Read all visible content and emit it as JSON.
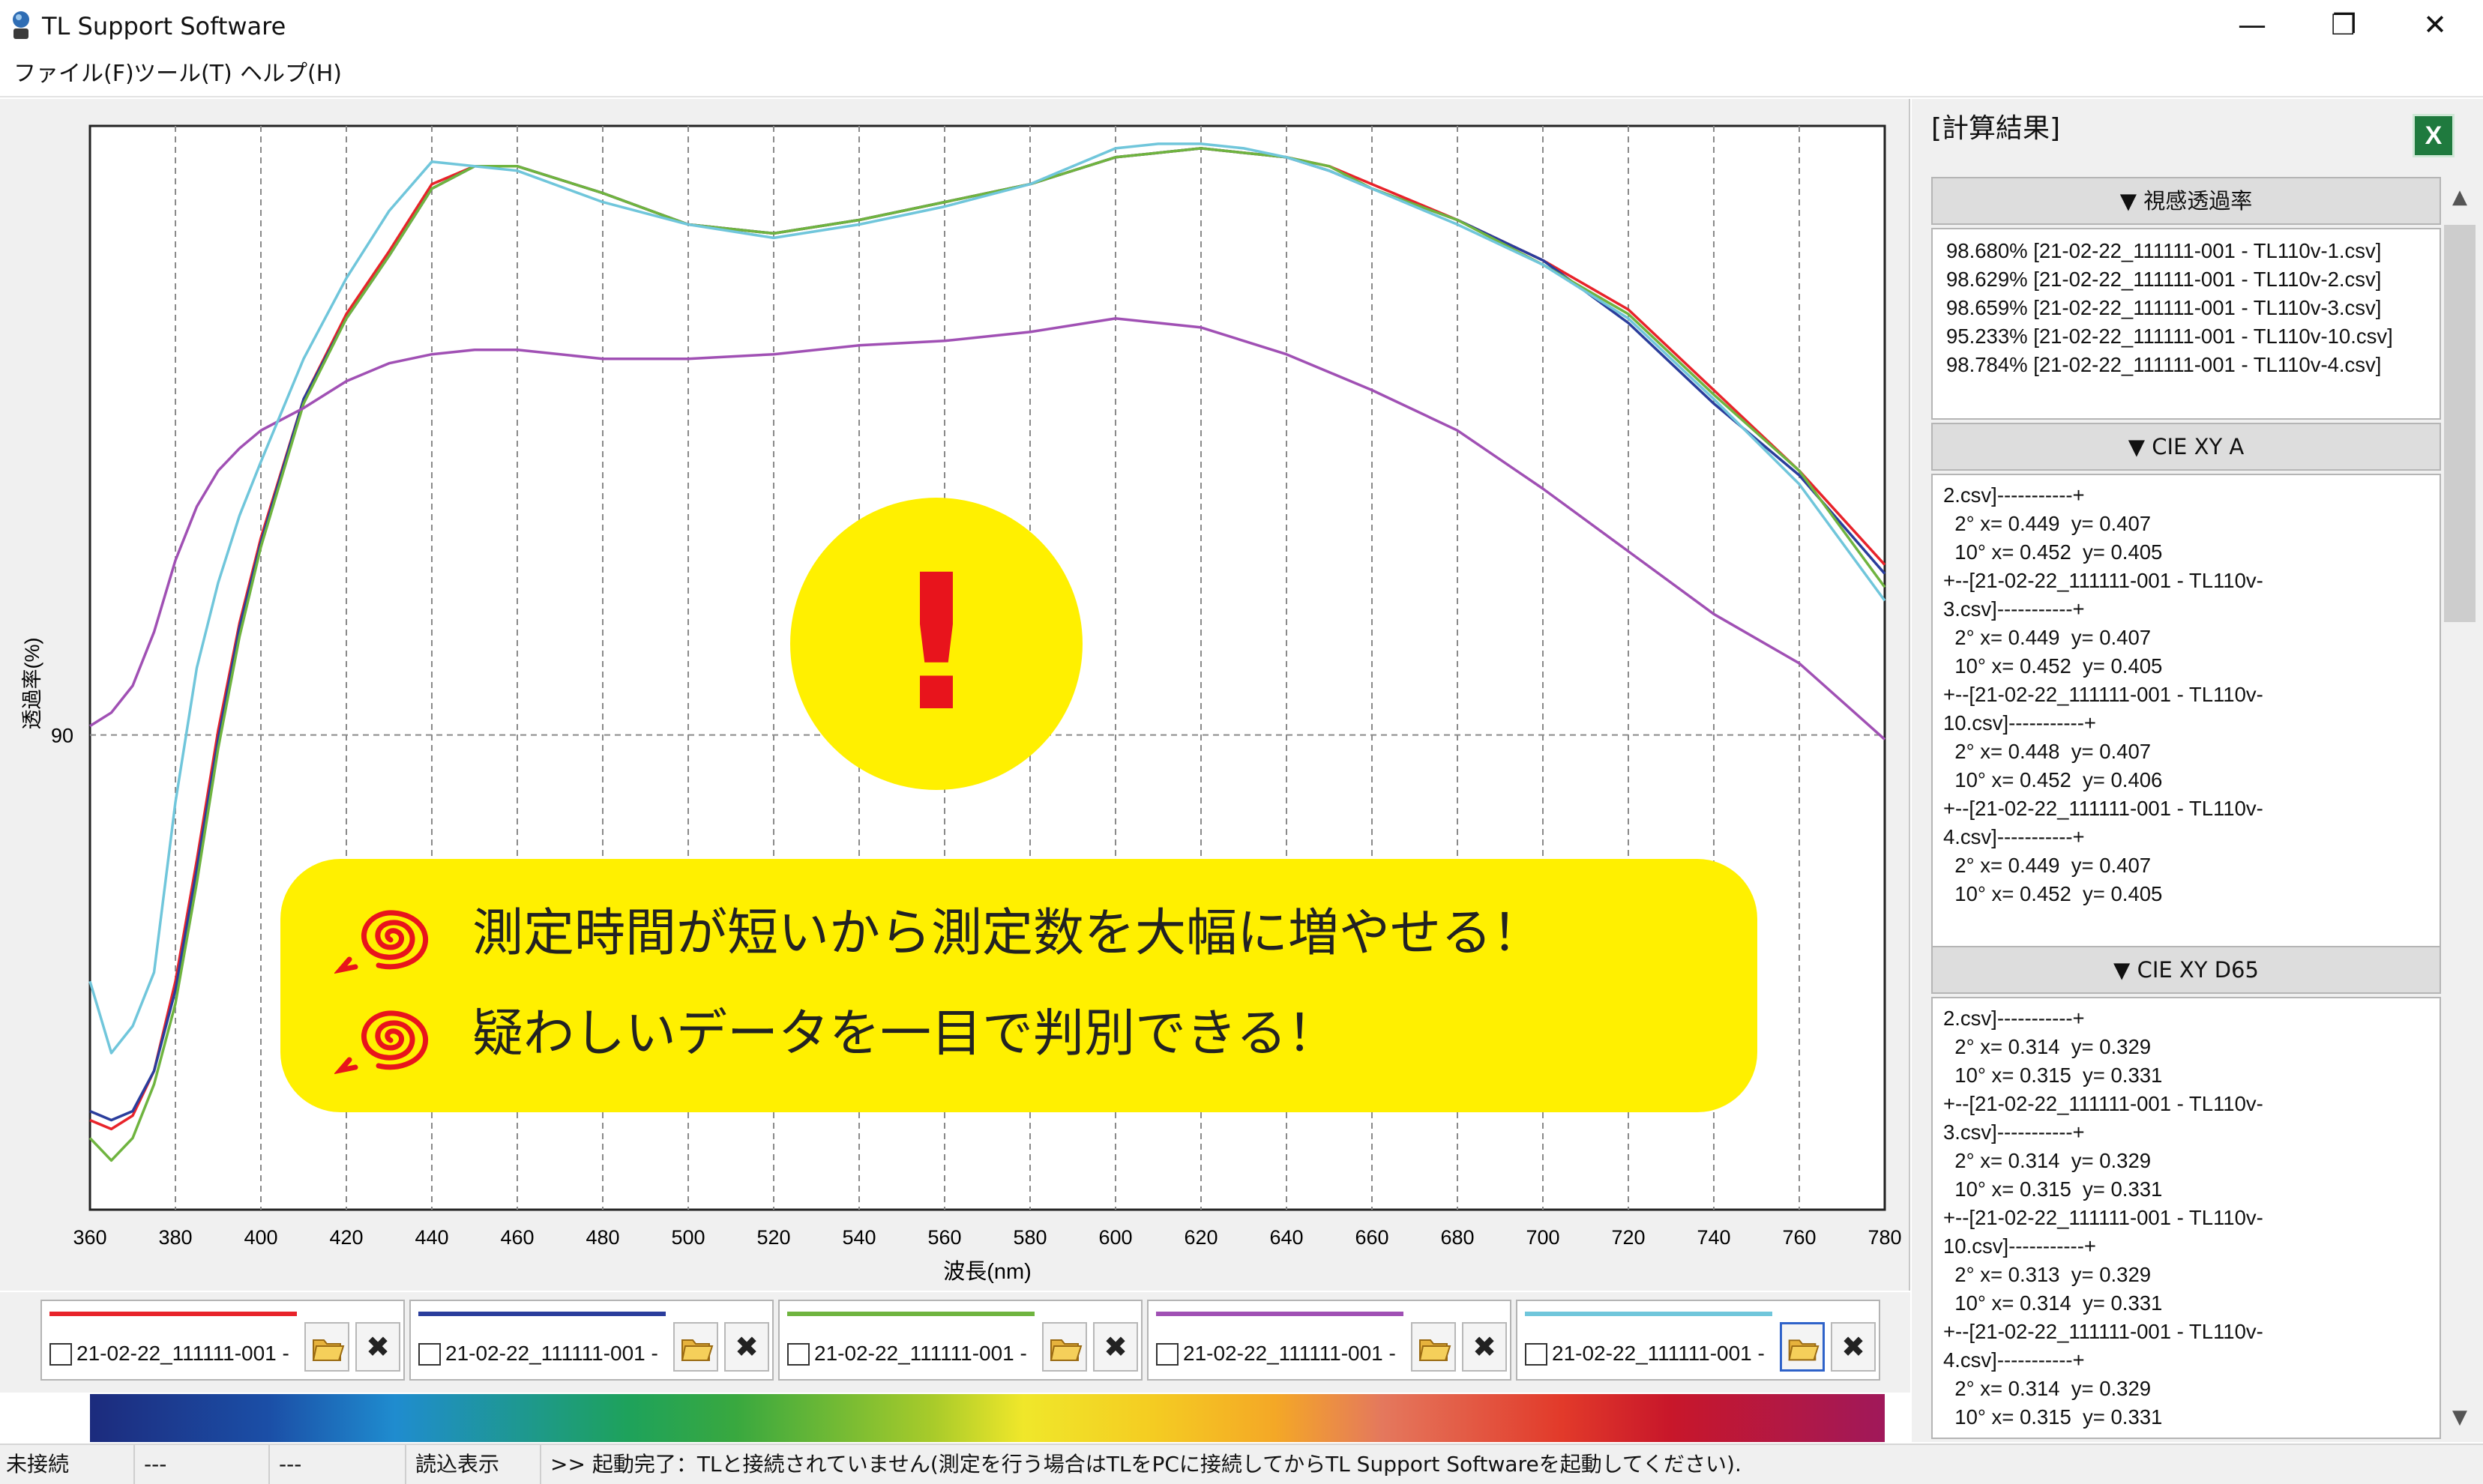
{
  "window": {
    "title": "TL Support Software",
    "controls": {
      "minimize": "—",
      "maximize": "❐",
      "close": "✕"
    }
  },
  "menu": [
    "ファイル(F)",
    "ツール(T)",
    "ヘルプ(H)"
  ],
  "chart_data": {
    "type": "line",
    "xlabel": "波長(nm)",
    "ylabel": "透過率(%)",
    "xlim": [
      360,
      780
    ],
    "x_ticks": [
      360,
      380,
      400,
      420,
      440,
      460,
      480,
      500,
      520,
      540,
      560,
      580,
      600,
      620,
      640,
      660,
      680,
      700,
      720,
      740,
      760,
      780
    ],
    "y_ticks": [
      90
    ],
    "y_tick_labels": [
      "90"
    ],
    "grid": true,
    "x": [
      360,
      365,
      370,
      375,
      380,
      385,
      390,
      395,
      400,
      410,
      420,
      430,
      440,
      450,
      460,
      480,
      500,
      520,
      540,
      560,
      580,
      600,
      610,
      620,
      630,
      640,
      650,
      660,
      680,
      700,
      720,
      740,
      760,
      780
    ],
    "series": [
      {
        "color": "#e8232a",
        "values": [
          89.14,
          89.12,
          89.15,
          89.25,
          89.45,
          89.72,
          90.01,
          90.25,
          90.44,
          90.75,
          90.94,
          91.08,
          91.23,
          91.27,
          91.27,
          91.21,
          91.14,
          91.12,
          91.15,
          91.19,
          91.23,
          91.29,
          91.3,
          91.31,
          91.3,
          91.29,
          91.27,
          91.23,
          91.15,
          91.06,
          90.95,
          90.77,
          90.59,
          90.38
        ]
      },
      {
        "color": "#2a3d9c",
        "values": [
          89.16,
          89.14,
          89.16,
          89.25,
          89.43,
          89.7,
          89.99,
          90.24,
          90.43,
          90.75,
          90.93,
          91.07,
          91.22,
          91.27,
          91.27,
          91.21,
          91.14,
          91.12,
          91.15,
          91.19,
          91.23,
          91.29,
          91.3,
          91.31,
          91.3,
          91.29,
          91.26,
          91.22,
          91.15,
          91.06,
          90.92,
          90.74,
          90.58,
          90.36
        ]
      },
      {
        "color": "#6fb43f",
        "values": [
          89.1,
          89.05,
          89.1,
          89.22,
          89.4,
          89.67,
          89.97,
          90.22,
          90.42,
          90.74,
          90.93,
          91.07,
          91.22,
          91.27,
          91.27,
          91.21,
          91.14,
          91.12,
          91.15,
          91.19,
          91.23,
          91.29,
          91.3,
          91.31,
          91.3,
          91.29,
          91.27,
          91.22,
          91.15,
          91.05,
          90.94,
          90.76,
          90.59,
          90.33
        ]
      },
      {
        "color": "#a050b4",
        "values": [
          90.02,
          90.05,
          90.11,
          90.23,
          90.39,
          90.51,
          90.59,
          90.64,
          90.68,
          90.73,
          90.79,
          90.83,
          90.85,
          90.86,
          90.86,
          90.84,
          90.84,
          90.85,
          90.87,
          90.88,
          90.9,
          90.93,
          90.92,
          90.91,
          90.88,
          90.85,
          90.81,
          90.77,
          90.68,
          90.55,
          90.41,
          90.27,
          90.16,
          89.99
        ]
      },
      {
        "color": "#70c6db",
        "values": [
          89.45,
          89.29,
          89.35,
          89.47,
          89.85,
          90.15,
          90.34,
          90.49,
          90.61,
          90.84,
          91.02,
          91.17,
          91.28,
          91.27,
          91.26,
          91.19,
          91.14,
          91.11,
          91.14,
          91.18,
          91.23,
          91.31,
          91.32,
          91.32,
          91.31,
          91.29,
          91.26,
          91.22,
          91.14,
          91.05,
          90.93,
          90.75,
          90.56,
          90.3
        ]
      }
    ]
  },
  "files": [
    {
      "label": "21-02-22_111111-001 -",
      "color": "#e8232a",
      "focused": false
    },
    {
      "label": "21-02-22_111111-001 -",
      "color": "#2a3d9c",
      "focused": false
    },
    {
      "label": "21-02-22_111111-001 -",
      "color": "#6fb43f",
      "focused": false
    },
    {
      "label": "21-02-22_111111-001 -",
      "color": "#a050b4",
      "focused": false
    },
    {
      "label": "21-02-22_111111-001 -",
      "color": "#70c6db",
      "focused": true
    }
  ],
  "results": {
    "title": "[計算結果]",
    "excel_icon": "excel-export-icon",
    "sections": [
      {
        "heading": "▼ 視感透過率",
        "lines": [
          "98.680% [21-02-22_111111-001 - TL110v-1.csv]",
          "98.629% [21-02-22_111111-001 - TL110v-2.csv]",
          "98.659% [21-02-22_111111-001 - TL110v-3.csv]",
          "95.233% [21-02-22_111111-001 - TL110v-10.csv]",
          "98.784% [21-02-22_111111-001 - TL110v-4.csv]"
        ]
      },
      {
        "heading": "▼ CIE XY A",
        "lines": [
          "2.csv]-----------+",
          "  2° x= 0.449  y= 0.407",
          "  10° x= 0.452  y= 0.405",
          "+--[21-02-22_111111-001 - TL110v-",
          "3.csv]-----------+",
          "  2° x= 0.449  y= 0.407",
          "  10° x= 0.452  y= 0.405",
          "+--[21-02-22_111111-001 - TL110v-",
          "10.csv]-----------+",
          "  2° x= 0.448  y= 0.407",
          "  10° x= 0.452  y= 0.406",
          "+--[21-02-22_111111-001 - TL110v-",
          "4.csv]-----------+",
          "  2° x= 0.449  y= 0.407",
          "  10° x= 0.452  y= 0.405"
        ]
      },
      {
        "heading": "▼ CIE XY D65",
        "lines": [
          "2.csv]-----------+",
          "  2° x= 0.314  y= 0.329",
          "  10° x= 0.315  y= 0.331",
          "+--[21-02-22_111111-001 - TL110v-",
          "3.csv]-----------+",
          "  2° x= 0.314  y= 0.329",
          "  10° x= 0.315  y= 0.331",
          "+--[21-02-22_111111-001 - TL110v-",
          "10.csv]-----------+",
          "  2° x= 0.313  y= 0.329",
          "  10° x= 0.314  y= 0.331",
          "+--[21-02-22_111111-001 - TL110v-",
          "4.csv]-----------+",
          "  2° x= 0.314  y= 0.329",
          "  10° x= 0.315  y= 0.331"
        ]
      }
    ]
  },
  "overlay": {
    "alert": "!",
    "lines": [
      "測定時間が短いから測定数を大幅に増やせる！",
      "疑わしいデータを一目で判別できる！"
    ],
    "accent": "#fff000",
    "alert_color": "#e8141c"
  },
  "status": {
    "connection": "未接続",
    "field2": "---",
    "field3": "---",
    "mode": "読込表示",
    "message": ">> 起動完了：TLと接続されていません(測定を行う場合はTLをPCに接続してからTL Support Softwareを起動してください)."
  }
}
